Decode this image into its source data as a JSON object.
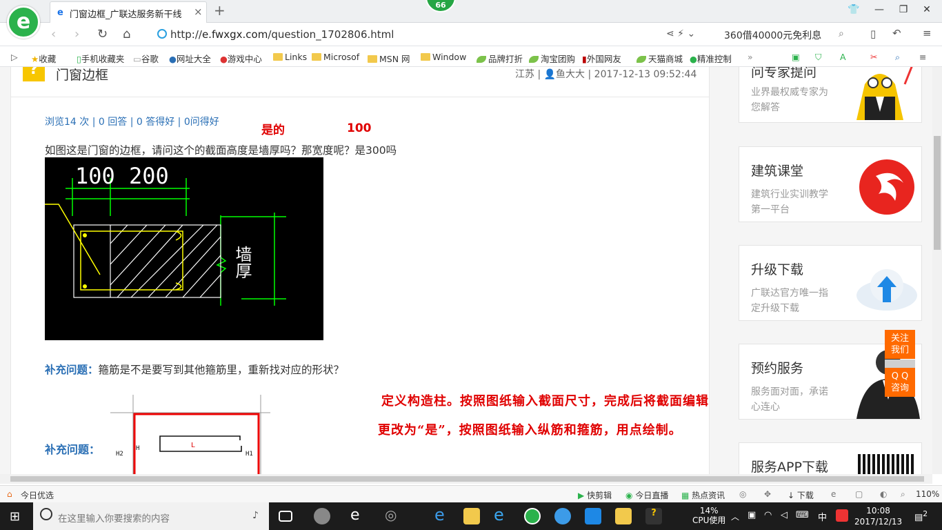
{
  "browser": {
    "logo": "e",
    "badge": "66",
    "tab": {
      "title": "门窗边框_广联达服务新干线",
      "close": "×"
    },
    "new_tab": "+",
    "url": {
      "scheme": "http://",
      "host": "e.fwxgx.com",
      "path": "/question_1702806.html"
    },
    "ad_text": "360借40000元免利息",
    "bookmarks": [
      "收藏",
      "手机收藏夹",
      "谷歌",
      "网址大全",
      "游戏中心",
      "Links",
      "Microsof",
      "MSN 网",
      "Window",
      "品牌打折",
      "淘宝团购",
      "外国网友",
      "天猫商城",
      "精准控制"
    ]
  },
  "question": {
    "title": "门窗边框",
    "meta": "江苏 | 👤鱼大大 | 2017-12-13 09:52:44",
    "stats": "浏览14 次 | 0 回答 | 0 答得好 | 0问得好",
    "body": "如图这是门窗的边框，请问这个的截面高度是墙厚吗？那宽度呢？是300吗",
    "supplement_label": "补充问题：",
    "supplement_1": "箍筋是不是要写到其他箍筋里，重新找对应的形状？",
    "supplement_2_label": "补充问题：",
    "figure1": {
      "dim_left": "100",
      "dim_right": "200",
      "wall_label": "墙厚"
    },
    "figure2": {
      "label_center": "L",
      "label_h1": "H1",
      "label_h2": "H2",
      "label_h": "H"
    }
  },
  "annotations": {
    "yes": "是的",
    "hundred": "100",
    "answer_line1": "定义构造柱。按照图纸输入截面尺寸，完成后将截面编辑",
    "answer_line2": "更改为“是”，按照图纸输入纵筋和箍筋，用点绘制。"
  },
  "sidebar": [
    {
      "title": "问专家提问",
      "desc": "业界最权威专家为您解答"
    },
    {
      "title": "建筑课堂",
      "desc": "建筑行业实训教学第一平台"
    },
    {
      "title": "升级下载",
      "desc": "广联达官方唯一指定升级下载"
    },
    {
      "title": "预约服务",
      "desc": "服务面对面，承诺心连心"
    },
    {
      "title": "服务APP下载",
      "desc": ""
    }
  ],
  "float_buttons": {
    "follow": "关注我们",
    "qq": "Q Q 咨询",
    "to_top": "︿"
  },
  "statusbar": {
    "left": "今日优选",
    "items": [
      "快剪辑",
      "今日直播",
      "热点资讯",
      "下载"
    ],
    "zoom": "110%"
  },
  "taskbar": {
    "search_placeholder": "在这里输入你要搜索的内容",
    "cpu_percent": "14%",
    "cpu_label": "CPU使用",
    "ime": "中",
    "time": "10:08",
    "date": "2017/12/13",
    "notifications": "2"
  },
  "colors": {
    "accent_red": "#e00000",
    "link_blue": "#2a6fb5",
    "brand_green": "#2bb24c",
    "orange": "#ff6a00"
  }
}
